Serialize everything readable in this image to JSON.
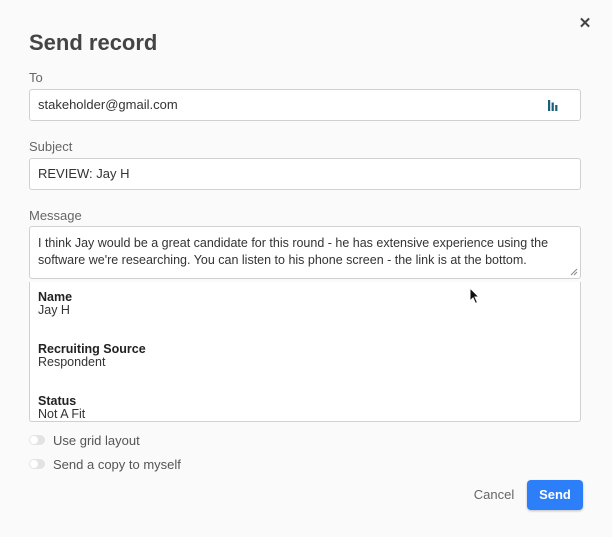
{
  "dialog": {
    "title": "Send record",
    "close_icon": "close-icon"
  },
  "to": {
    "label": "To",
    "value": "stakeholder@gmail.com",
    "icon": "contact-picker-icon"
  },
  "subject": {
    "label": "Subject",
    "value": "REVIEW: Jay H"
  },
  "message": {
    "label": "Message",
    "value": "I think Jay would be a great candidate for this round - he has extensive experience using the software we're researching. You can listen to his phone screen - the link is at the bottom."
  },
  "record": {
    "fields": [
      {
        "name": "Name",
        "value": "Jay H"
      },
      {
        "name": "Recruiting Source",
        "value": "Respondent"
      },
      {
        "name": "Status",
        "value": "Not A Fit"
      }
    ]
  },
  "options": {
    "grid_layout_label": "Use grid layout",
    "grid_layout_on": false,
    "copy_self_label": "Send a copy to myself",
    "copy_self_on": false
  },
  "actions": {
    "cancel_label": "Cancel",
    "send_label": "Send"
  },
  "colors": {
    "accent": "#2d7ff9",
    "contact_icon": "#1a5f7a"
  }
}
